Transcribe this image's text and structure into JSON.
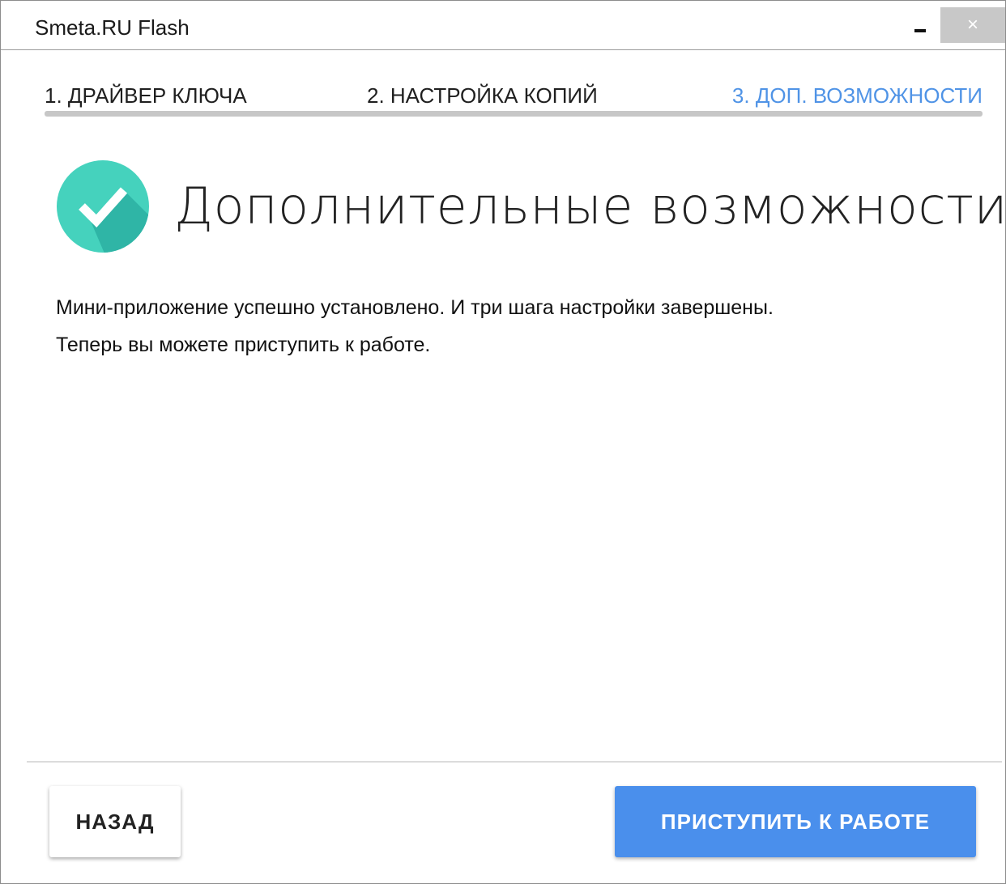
{
  "window": {
    "title": "Smeta.RU Flash",
    "minimize_glyph": "minimize-icon",
    "close_glyph": "×"
  },
  "steps": [
    {
      "label": "1. ДРАЙВЕР КЛЮЧА",
      "active": false
    },
    {
      "label": "2. НАСТРОЙКА КОПИЙ",
      "active": false
    },
    {
      "label": "3. ДОП. ВОЗМОЖНОСТИ",
      "active": true
    }
  ],
  "progress": 1.0,
  "hero": {
    "icon": "check-circle-icon",
    "title": "Дополнительные возможности"
  },
  "message": {
    "line1": "Мини-приложение успешно установлено. И три шага настройки завершены.",
    "line2": "Теперь вы можете приступить к работе."
  },
  "buttons": {
    "back_label": "НАЗАД",
    "start_label": "ПРИСТУПИТЬ К РАБОТЕ"
  },
  "colors": {
    "accent": "#4a8fec",
    "active_step": "#4f93e6",
    "icon_teal": "#3ec9b5",
    "icon_teal_dark": "#2bb3a2"
  }
}
